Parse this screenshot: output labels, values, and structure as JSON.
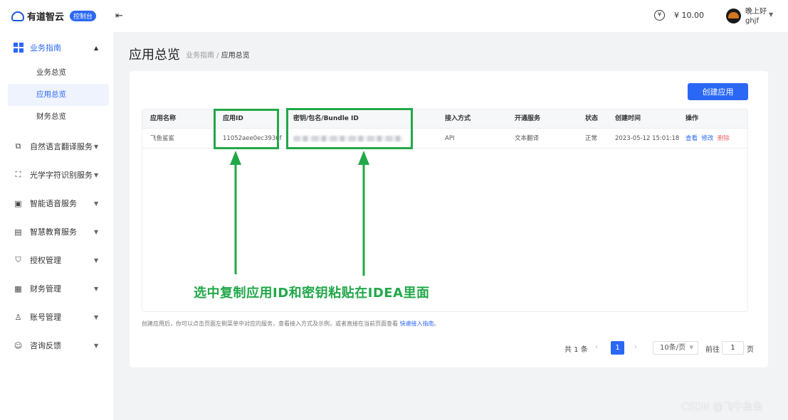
{
  "brand": {
    "name": "有道智云",
    "badge": "控制台"
  },
  "header": {
    "collapse_icon": "menu-fold-icon",
    "wallet_icon": "wallet-icon",
    "balance": "¥ 10.00",
    "greeting": "晚上好",
    "username": "ghjf"
  },
  "sidebar": {
    "groups": [
      {
        "label": "业务指南",
        "icon": "dashboard-icon",
        "expanded": true,
        "children": [
          "业务总览",
          "应用总览",
          "财务总览"
        ],
        "selected": "应用总览"
      },
      {
        "label": "自然语言翻译服务",
        "icon": "translate-icon"
      },
      {
        "label": "光学字符识别服务",
        "icon": "scan-icon"
      },
      {
        "label": "智能语音服务",
        "icon": "voice-icon"
      },
      {
        "label": "智慧教育服务",
        "icon": "education-icon"
      },
      {
        "label": "授权管理",
        "icon": "shield-icon"
      },
      {
        "label": "财务管理",
        "icon": "finance-icon"
      },
      {
        "label": "账号管理",
        "icon": "user-icon"
      },
      {
        "label": "咨询反馈",
        "icon": "chat-icon"
      }
    ]
  },
  "page": {
    "title": "应用总览",
    "breadcrumb_parent": "业务指南",
    "breadcrumb_sep": " / ",
    "breadcrumb_current": "应用总览",
    "create_button": "创建应用"
  },
  "table": {
    "columns": [
      "应用名称",
      "应用ID",
      "密钥/包名/Bundle ID",
      "接入方式",
      "开通服务",
      "状态",
      "创建时间",
      "操作"
    ],
    "rows": [
      {
        "name": "飞鱼鲨鲨",
        "app_id": "11052aee0ec3936f",
        "secret": "",
        "access": "API",
        "service": "文本翻译",
        "status": "正常",
        "created": "2023-05-12 15:01:18",
        "actions": [
          "查看",
          "修改",
          "删除"
        ]
      }
    ]
  },
  "footnote": {
    "text": "创建应用后，你可以点击页面左侧菜单中对应的服务，查看接入方式及示例，或者直接在当前页面查看 ",
    "link": "快速接入指南",
    "end": "。"
  },
  "pagination": {
    "total": "共 1 条",
    "current_page": "1",
    "page_size": "10条/页",
    "goto_label": "前往",
    "goto_value": "1",
    "page_label": "页"
  },
  "annotation": {
    "text": "选中复制应用ID和密钥粘贴在IDEA里面",
    "color": "#22a84a"
  },
  "watermark": "CSDN @飞牛鱼鱼",
  "colors": {
    "primary": "#2a67f5",
    "danger": "#f56c6c",
    "annotation": "#22a84a",
    "bg": "#f2f3f5"
  }
}
